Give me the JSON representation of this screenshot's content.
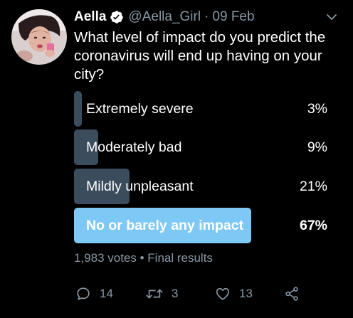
{
  "tweet": {
    "author_name": "Aella",
    "handle": "@Aella_Girl",
    "separator": "·",
    "date": "09 Feb",
    "text": "What level of impact do you predict the coronavirus will end up having on your city?"
  },
  "poll": {
    "options": [
      {
        "label": "Extremely severe",
        "percent_text": "3%",
        "percent": 3,
        "winner": false
      },
      {
        "label": "Moderately bad",
        "percent_text": "9%",
        "percent": 9,
        "winner": false
      },
      {
        "label": "Mildly unpleasant",
        "percent_text": "21%",
        "percent": 21,
        "winner": false
      },
      {
        "label": "No or barely any impact",
        "percent_text": "67%",
        "percent": 67,
        "winner": true
      }
    ],
    "meta": "1,983 votes • Final results"
  },
  "actions": {
    "reply_count": "14",
    "retweet_count": "3",
    "like_count": "13"
  },
  "colors": {
    "background": "#000000",
    "bar": "#3b4c5c",
    "winner_bar": "#7ec8f5",
    "secondary_text": "#8899a6",
    "verified": "#ffffff"
  },
  "icons": {
    "verified": "verified-badge-icon",
    "caret": "chevron-down-icon",
    "reply": "reply-icon",
    "retweet": "retweet-icon",
    "like": "heart-icon",
    "share": "share-icon"
  }
}
